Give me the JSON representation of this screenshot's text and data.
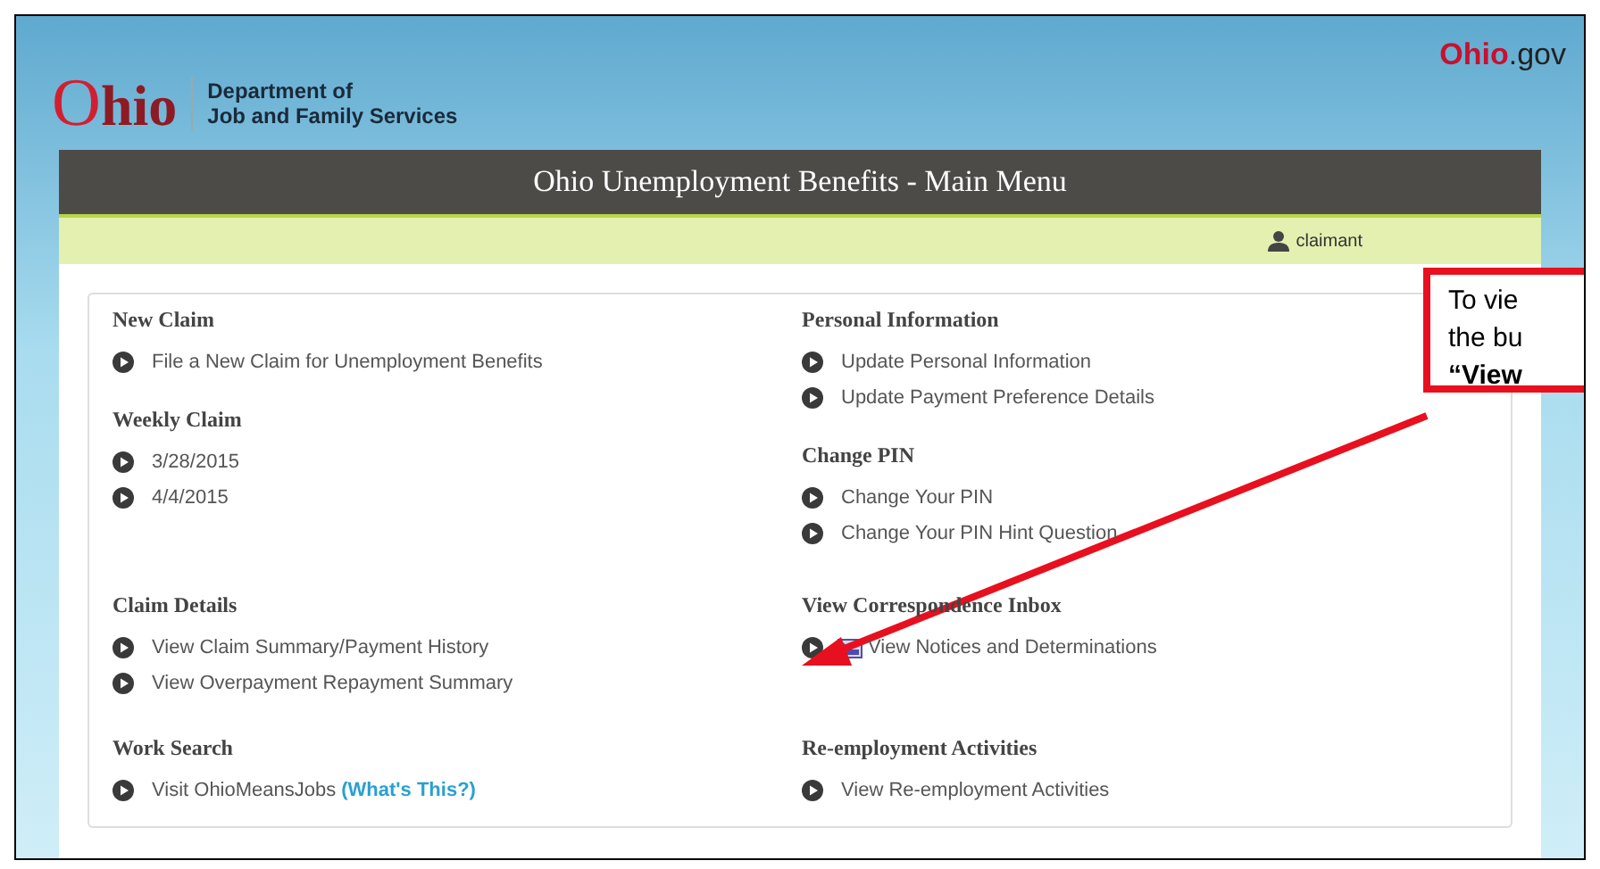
{
  "header": {
    "logo_word": "Ohio",
    "department": [
      "Department of",
      "Job and Family Services"
    ],
    "portal": {
      "name": "Ohio",
      "suffix": ".gov"
    }
  },
  "title_bar": {
    "title": "Ohio Unemployment Benefits - Main Menu"
  },
  "user_bar": {
    "user": "claimant"
  },
  "menu_rows": [
    {
      "cells": [
        [
          {
            "heading": "New Claim",
            "items": [
              {
                "kind": "plain",
                "label": "File a New Claim for Unemployment Benefits"
              }
            ]
          },
          {
            "heading": "Weekly Claim",
            "items": [
              {
                "kind": "plain",
                "label": "3/28/2015"
              },
              {
                "kind": "plain",
                "label": "4/4/2015"
              }
            ]
          }
        ],
        [
          {
            "heading": "Personal Information",
            "items": [
              {
                "kind": "plain",
                "label": "Update Personal Information"
              },
              {
                "kind": "plain",
                "label": "Update Payment Preference Details"
              }
            ]
          },
          {
            "heading": "Change PIN",
            "items": [
              {
                "kind": "plain",
                "label": "Change Your PIN"
              },
              {
                "kind": "plain",
                "label": "Change Your PIN Hint Question"
              }
            ]
          }
        ]
      ]
    },
    {
      "cells": [
        [
          {
            "heading": "Claim Details",
            "items": [
              {
                "kind": "plain",
                "label": "View Claim Summary/Payment History"
              },
              {
                "kind": "plain",
                "label": "View Overpayment Repayment Summary"
              }
            ]
          }
        ],
        [
          {
            "heading": "View Correspondence Inbox",
            "items": [
              {
                "kind": "inbox",
                "label": "View Notices and Determinations"
              }
            ]
          }
        ]
      ]
    },
    {
      "cells": [
        [
          {
            "heading": "Work Search",
            "items": [
              {
                "kind": "help",
                "label": "Visit OhioMeansJobs",
                "help": "(What's This?)"
              }
            ]
          }
        ],
        [
          {
            "heading": "Re-employment Activities",
            "items": [
              {
                "kind": "plain",
                "label": "View Re-employment Activities"
              }
            ]
          }
        ]
      ]
    }
  ],
  "callout": {
    "lines": [
      "To vie",
      "the bu",
      "“View"
    ]
  }
}
